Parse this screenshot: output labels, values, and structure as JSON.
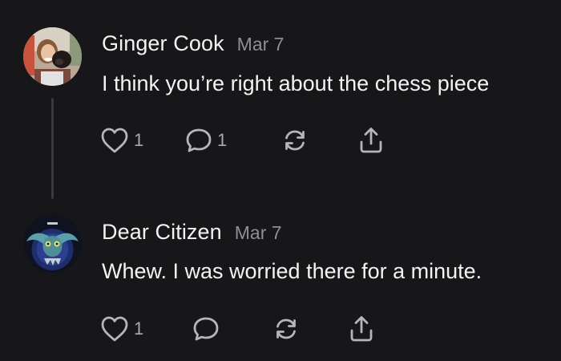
{
  "comments": [
    {
      "author": "Ginger Cook",
      "date": "Mar 7",
      "text": "I think you’re right about the chess piece",
      "likes": "1",
      "replies": "1",
      "avatar_icon": "person-with-dog-photo"
    },
    {
      "author": "Dear Citizen",
      "date": "Mar 7",
      "text": "Whew. I was worried there for a minute.",
      "likes": "1",
      "replies": "",
      "avatar_icon": "winged-owl-artwork"
    }
  ],
  "icons": {
    "like": "heart-icon",
    "reply": "speech-bubble-icon",
    "repost": "repost-arrows-icon",
    "share": "share-upload-icon"
  },
  "colors": {
    "background": "#17171a",
    "text": "#f3f3f3",
    "muted": "#8e8e93",
    "icon": "#b5b5ba",
    "thread_line": "#3a3a3d"
  }
}
